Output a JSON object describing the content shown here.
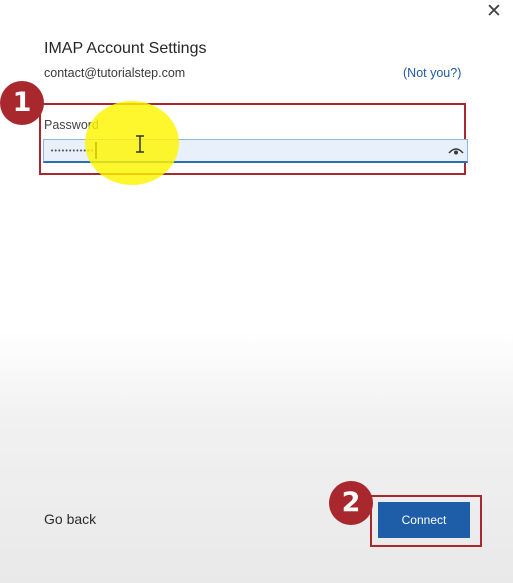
{
  "dialog": {
    "title": "IMAP Account Settings",
    "email": "contact@tutorialstep.com",
    "not_you_link": "(Not you?)",
    "close_glyph": "✕"
  },
  "password": {
    "label": "Password",
    "masked_value": "••••••••••••",
    "reveal_icon": "eye-icon"
  },
  "footer": {
    "go_back_label": "Go back",
    "connect_label": "Connect"
  },
  "annotations": {
    "step_1": "1",
    "step_2": "2",
    "highlight_color": "#a8282d",
    "cursor_highlight_color": "#fff500"
  },
  "colors": {
    "accent": "#1e5ea8",
    "link": "#1f5aa6",
    "input_focus": "#2a6ebb"
  }
}
